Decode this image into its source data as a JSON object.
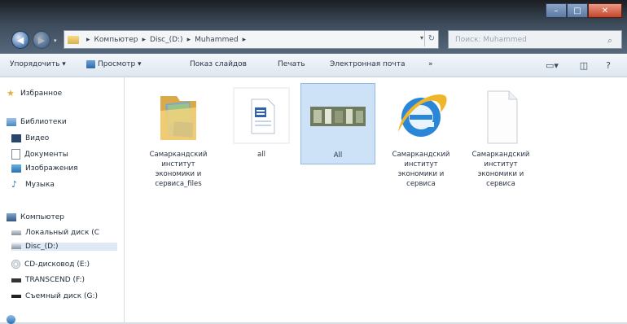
{
  "address": {
    "crumbs": [
      "Компьютер",
      "Disc_(D:)",
      "Muhammed"
    ],
    "separator": "▸",
    "search_placeholder": "Поиск: Muhammed"
  },
  "toolbar": {
    "organize": "Упорядочить ▾",
    "view": "Просмотр ▾",
    "slideshow": "Показ слайдов",
    "print": "Печать",
    "email": "Электронная почта",
    "more": "»"
  },
  "sidebar": {
    "favorites": "Избранное",
    "libraries": "Библиотеки",
    "video": "Видео",
    "documents": "Документы",
    "images": "Изображения",
    "music": "Музыка",
    "computer": "Компьютер",
    "drives": [
      "Локальный диск (C",
      "Disc_(D:)",
      "CD-дисковод (E:)",
      "TRANSCEND (F:)",
      "Съемный диск (G:)"
    ]
  },
  "files": [
    {
      "name": "Самаркандский институт экономики и сервиса_files",
      "icon": "folder-icon"
    },
    {
      "name": "all",
      "icon": "document-icon"
    },
    {
      "name": "All",
      "icon": "image-icon"
    },
    {
      "name": "Самаркандский институт экономики и сервиса",
      "icon": "internet-explorer-icon"
    },
    {
      "name": "Самаркандский институт экономики и сервиса",
      "icon": "blank-file-icon"
    }
  ],
  "colors": {
    "accent": "#2e69a8",
    "selection": "#cde2f7"
  }
}
